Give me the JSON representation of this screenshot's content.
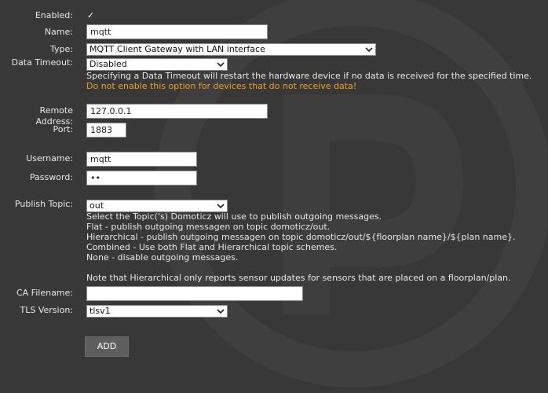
{
  "form": {
    "enabled": {
      "label": "Enabled:",
      "check_glyph": "✓"
    },
    "name": {
      "label": "Name:",
      "value": "mqtt"
    },
    "type": {
      "label": "Type:",
      "selected": "MQTT Client Gateway with LAN interface"
    },
    "data_timeout": {
      "label": "Data Timeout:",
      "selected": "Disabled",
      "help": "Specifying a Data Timeout will restart the hardware device if no data is received for the specified time.",
      "warning": "Do not enable this option for devices that do not receive data!"
    },
    "remote_address": {
      "label": "Remote Address:",
      "value": "127.0.0.1"
    },
    "port": {
      "label": "Port:",
      "value": "1883"
    },
    "username": {
      "label": "Username:",
      "value": "mqtt"
    },
    "password": {
      "label": "Password:",
      "value": "••"
    },
    "publish_topic": {
      "label": "Publish Topic:",
      "selected": "out",
      "help_lines": [
        "Select the Topic('s) Domoticz will use to publish outgoing messages.",
        "Flat - publish outgoing messagen on topic domoticz/out.",
        "Hierarchical - publish outgoing messagen on topic domoticz/out/${floorplan name}/${plan name}.",
        "Combined - Use both Flat and Hierarchical topic schemes.",
        "None - disable outgoing messages."
      ],
      "note": "Note that Hierarchical only reports sensor updates for sensors that are placed on a floorplan/plan."
    },
    "ca_filename": {
      "label": "CA Filename:",
      "value": ""
    },
    "tls_version": {
      "label": "TLS Version:",
      "selected": "tlsv1"
    },
    "add_button": "ADD"
  },
  "colors": {
    "background": "#383838",
    "warning": "#f0a020",
    "button": "#5e5e5e"
  }
}
